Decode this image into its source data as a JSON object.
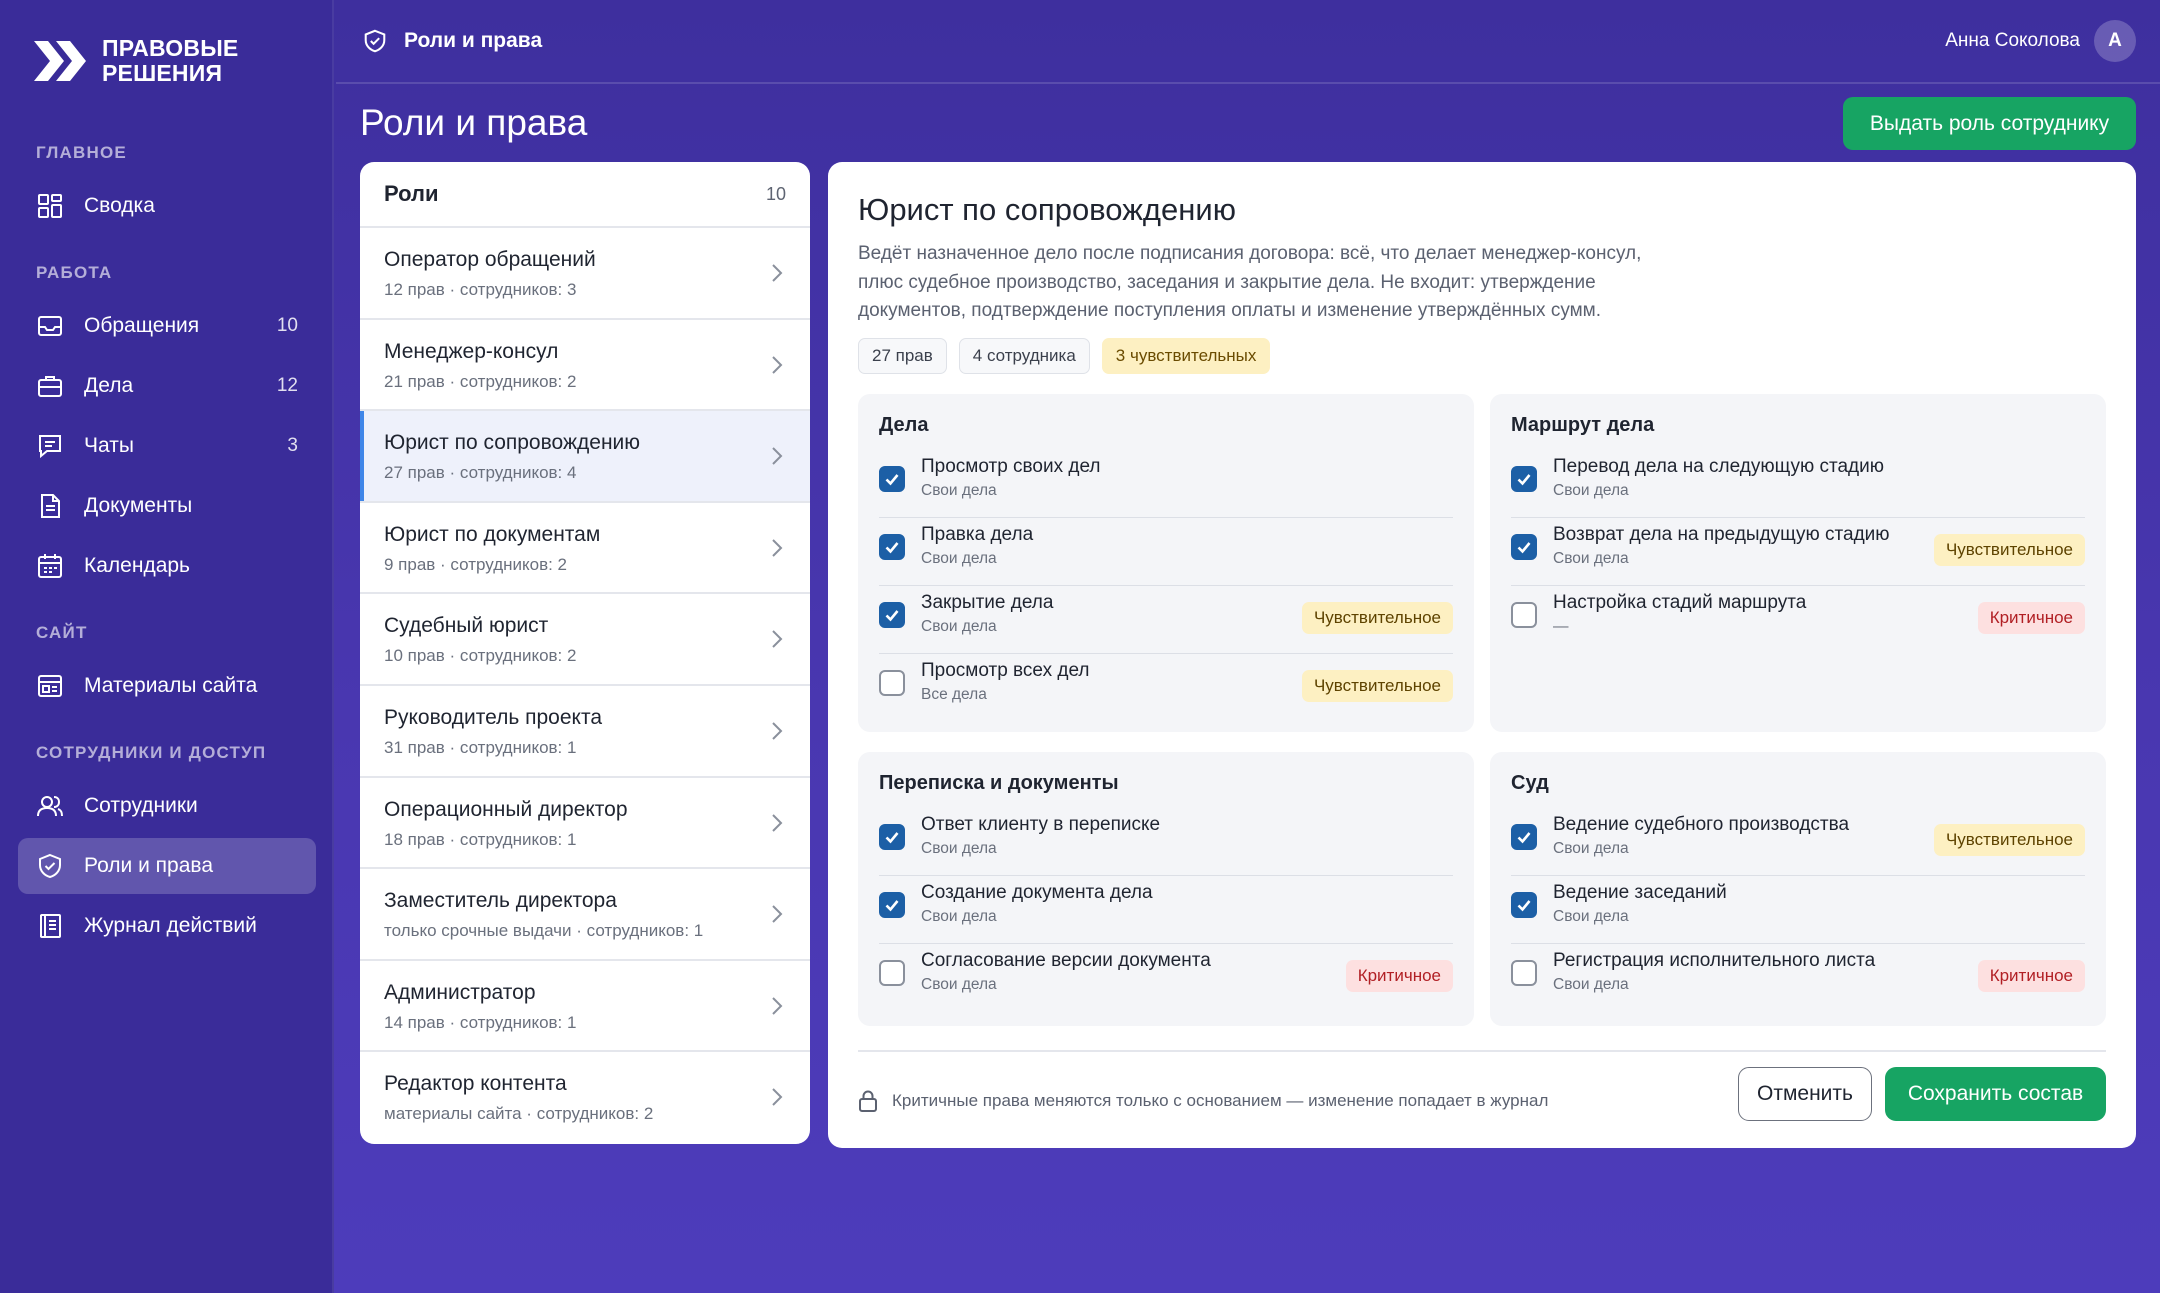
{
  "brand": {
    "line1": "ПРАВОВЫЕ",
    "line2": "РЕШЕНИЯ"
  },
  "sidebar": {
    "sections": [
      "ГЛАВНОЕ",
      "РАБОТА",
      "САЙТ",
      "СОТРУДНИКИ И ДОСТУП"
    ],
    "items": [
      {
        "label": "Сводка",
        "icon": "dashboard-icon",
        "count": ""
      },
      {
        "label": "Обращения",
        "icon": "inbox-icon",
        "count": "10"
      },
      {
        "label": "Дела",
        "icon": "briefcase-icon",
        "count": "12"
      },
      {
        "label": "Чаты",
        "icon": "chat-icon",
        "count": "3"
      },
      {
        "label": "Документы",
        "icon": "document-icon",
        "count": ""
      },
      {
        "label": "Календарь",
        "icon": "calendar-icon",
        "count": ""
      },
      {
        "label": "Материалы сайта",
        "icon": "site-materials-icon",
        "count": ""
      },
      {
        "label": "Сотрудники",
        "icon": "users-icon",
        "count": ""
      },
      {
        "label": "Роли и права",
        "icon": "shield-icon",
        "count": "",
        "active": true
      },
      {
        "label": "Журнал действий",
        "icon": "log-icon",
        "count": ""
      }
    ]
  },
  "topbar": {
    "breadcrumb": "Роли и права",
    "user_name": "Анна Соколова",
    "avatar_initial": "А"
  },
  "page": {
    "title": "Роли и права",
    "assign_button": "Выдать роль сотруднику"
  },
  "roles": {
    "header": "Роли",
    "count": "10",
    "items": [
      {
        "name": "Оператор обращений",
        "meta": "12 прав · сотрудников: 3"
      },
      {
        "name": "Менеджер-консул",
        "meta": "21 прав · сотрудников: 2"
      },
      {
        "name": "Юрист по сопровождению",
        "meta": "27 прав · сотрудников: 4",
        "active": true
      },
      {
        "name": "Юрист по документам",
        "meta": "9 прав · сотрудников: 2"
      },
      {
        "name": "Судебный юрист",
        "meta": "10 прав · сотрудников: 2"
      },
      {
        "name": "Руководитель проекта",
        "meta": "31 прав · сотрудников: 1"
      },
      {
        "name": "Операционный директор",
        "meta": "18 прав · сотрудников: 1"
      },
      {
        "name": "Заместитель директора",
        "meta": "только срочные выдачи · сотрудников: 1"
      },
      {
        "name": "Администратор",
        "meta": "14 прав · сотрудников: 1"
      },
      {
        "name": "Редактор контента",
        "meta": "материалы сайта · сотрудников: 2"
      }
    ]
  },
  "detail": {
    "title": "Юрист по сопровождению",
    "description": "Ведёт назначенное дело после подписания договора: всё, что делает менеджер-консул, плюс судебное производство, заседания и закрытие дела. Не входит: утверждение документов, подтверждение поступления оплаты и изменение утверждённых сумм.",
    "chips": [
      "27 прав",
      "4 сотрудника",
      "3 чувствительных"
    ],
    "groups": [
      {
        "title": "Дела",
        "perms": [
          {
            "label": "Просмотр своих дел",
            "scope": "Свои дела",
            "checked": true,
            "tag": ""
          },
          {
            "label": "Правка дела",
            "scope": "Свои дела",
            "checked": true,
            "tag": ""
          },
          {
            "label": "Закрытие дела",
            "scope": "Свои дела",
            "checked": true,
            "tag": "Чувствительное"
          },
          {
            "label": "Просмотр всех дел",
            "scope": "Все дела",
            "checked": false,
            "tag": "Чувствительное"
          }
        ]
      },
      {
        "title": "Маршрут дела",
        "perms": [
          {
            "label": "Перевод дела на следующую стадию",
            "scope": "Свои дела",
            "checked": true,
            "tag": ""
          },
          {
            "label": "Возврат дела на предыдущую стадию",
            "scope": "Свои дела",
            "checked": true,
            "tag": "Чувствительное"
          },
          {
            "label": "Настройка стадий маршрута",
            "scope": "—",
            "checked": false,
            "tag": "Критичное"
          }
        ]
      },
      {
        "title": "Переписка и документы",
        "perms": [
          {
            "label": "Ответ клиенту в переписке",
            "scope": "Свои дела",
            "checked": true,
            "tag": ""
          },
          {
            "label": "Создание документа дела",
            "scope": "Свои дела",
            "checked": true,
            "tag": ""
          },
          {
            "label": "Согласование версии документа",
            "scope": "Свои дела",
            "checked": false,
            "tag": "Критичное"
          }
        ]
      },
      {
        "title": "Суд",
        "perms": [
          {
            "label": "Ведение судебного производства",
            "scope": "Свои дела",
            "checked": true,
            "tag": "Чувствительное"
          },
          {
            "label": "Ведение заседаний",
            "scope": "Свои дела",
            "checked": true,
            "tag": ""
          },
          {
            "label": "Регистрация исполнительного листа",
            "scope": "Свои дела",
            "checked": false,
            "tag": "Критичное"
          }
        ]
      }
    ],
    "footer_note": "Критичные права меняются только с основанием — изменение попадает в журнал",
    "cancel_button": "Отменить",
    "save_button": "Сохранить состав"
  },
  "colors": {
    "accent_green": "#17a463",
    "check_blue": "#1c5fa6",
    "bg_purple": "#3e2f9e"
  }
}
